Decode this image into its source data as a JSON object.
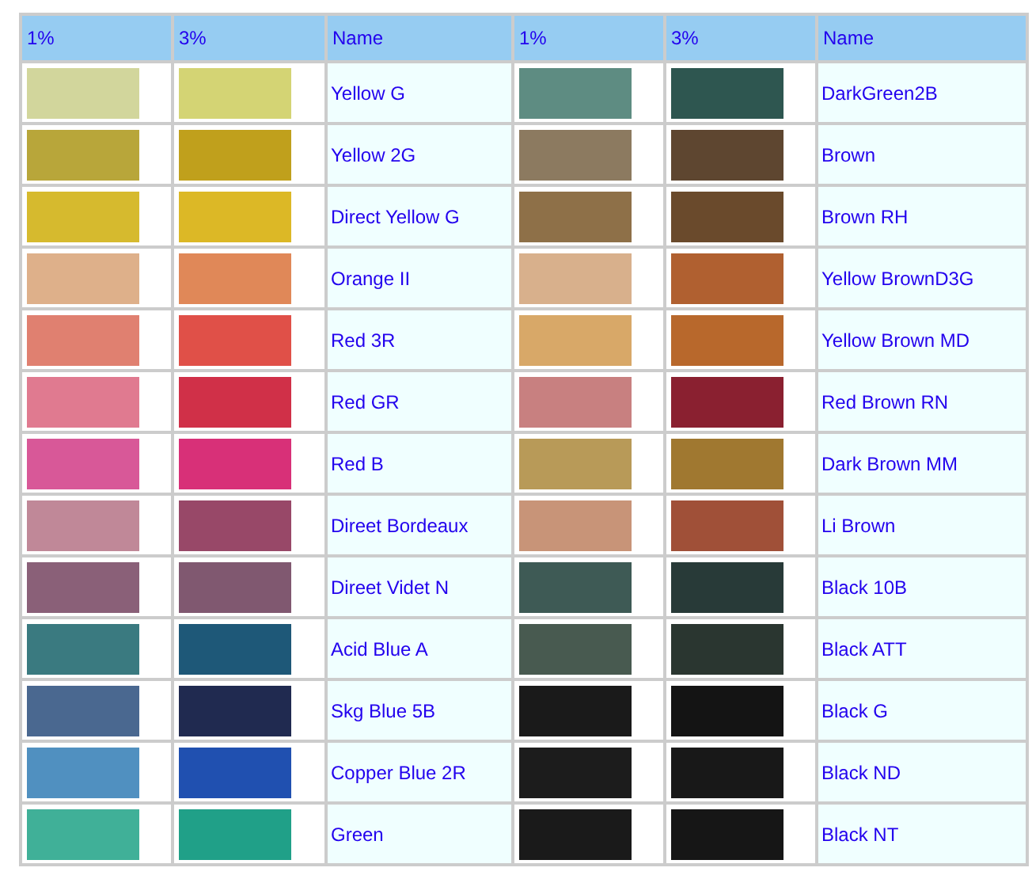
{
  "table": {
    "columns": [
      "1%",
      "3%",
      "Name",
      "1%",
      "3%",
      "Name"
    ],
    "rows": [
      {
        "samples": [
          {
            "swatches": [
              {
                "color": "#d2d69c"
              },
              {
                "color": "#d4d474"
              }
            ],
            "name": "Yellow G"
          },
          {
            "swatches": [
              {
                "color": "#5e8c82"
              },
              {
                "color": "#2e5650"
              }
            ],
            "name": "DarkGreen2B"
          }
        ]
      },
      {
        "samples": [
          {
            "swatches": [
              {
                "color": "#b8a63a"
              },
              {
                "color": "#c0a01c"
              }
            ],
            "name": "Yellow 2G"
          },
          {
            "swatches": [
              {
                "color": "#8c7a60"
              },
              {
                "color": "#5e4630"
              }
            ],
            "name": "Brown"
          }
        ]
      },
      {
        "samples": [
          {
            "swatches": [
              {
                "color": "#d6ba2e"
              },
              {
                "color": "#dcb826"
              }
            ],
            "name": "Direct Yellow G"
          },
          {
            "swatches": [
              {
                "color": "#8e7048"
              },
              {
                "color": "#6a4a2c"
              }
            ],
            "name": "Brown RH"
          }
        ]
      },
      {
        "samples": [
          {
            "swatches": [
              {
                "color": "#deb08a"
              },
              {
                "color": "#e08858"
              }
            ],
            "name": "Orange II"
          },
          {
            "swatches": [
              {
                "color": "#d8b08c"
              },
              {
                "color": "#b06030"
              }
            ],
            "name": "Yellow BrownD3G"
          }
        ]
      },
      {
        "samples": [
          {
            "swatches": [
              {
                "color": "#e08070"
              },
              {
                "color": "#e05048"
              }
            ],
            "name": "Red 3R"
          },
          {
            "swatches": [
              {
                "color": "#d8a868"
              },
              {
                "color": "#b8682c"
              }
            ],
            "name": "Yellow Brown MD"
          }
        ]
      },
      {
        "samples": [
          {
            "swatches": [
              {
                "color": "#e07a90"
              },
              {
                "color": "#d03048"
              }
            ],
            "name": "Red GR"
          },
          {
            "swatches": [
              {
                "color": "#c88080"
              },
              {
                "color": "#8a2030"
              }
            ],
            "name": "Red Brown RN"
          }
        ]
      },
      {
        "samples": [
          {
            "swatches": [
              {
                "color": "#d85898"
              },
              {
                "color": "#d83078"
              }
            ],
            "name": "Red B"
          },
          {
            "swatches": [
              {
                "color": "#b89a58"
              },
              {
                "color": "#a07830"
              }
            ],
            "name": "Dark Brown MM"
          }
        ]
      },
      {
        "samples": [
          {
            "swatches": [
              {
                "color": "#c08898"
              },
              {
                "color": "#984868"
              }
            ],
            "name": "Direet Bordeaux"
          },
          {
            "swatches": [
              {
                "color": "#c89478"
              },
              {
                "color": "#a05038"
              }
            ],
            "name": "Li Brown"
          }
        ]
      },
      {
        "samples": [
          {
            "swatches": [
              {
                "color": "#8a6078"
              },
              {
                "color": "#805870"
              }
            ],
            "name": "Direet Videt N"
          },
          {
            "swatches": [
              {
                "color": "#3e5a55"
              },
              {
                "color": "#283a38"
              }
            ],
            "name": "Black 10B"
          }
        ]
      },
      {
        "samples": [
          {
            "swatches": [
              {
                "color": "#3a7a80"
              },
              {
                "color": "#1e5878"
              }
            ],
            "name": "Acid Blue A"
          },
          {
            "swatches": [
              {
                "color": "#485a50"
              },
              {
                "color": "#2a3630"
              }
            ],
            "name": "Black ATT"
          }
        ]
      },
      {
        "samples": [
          {
            "swatches": [
              {
                "color": "#4a6890"
              },
              {
                "color": "#202a50"
              }
            ],
            "name": "Skg Blue 5B"
          },
          {
            "swatches": [
              {
                "color": "#1a1a1a"
              },
              {
                "color": "#141414"
              }
            ],
            "name": "Black G"
          }
        ]
      },
      {
        "samples": [
          {
            "swatches": [
              {
                "color": "#5090c0"
              },
              {
                "color": "#2050b0"
              }
            ],
            "name": "Copper Blue 2R"
          },
          {
            "swatches": [
              {
                "color": "#1c1c1c"
              },
              {
                "color": "#181818"
              }
            ],
            "name": "Black ND"
          }
        ]
      },
      {
        "samples": [
          {
            "swatches": [
              {
                "color": "#40b098"
              },
              {
                "color": "#20a088"
              }
            ],
            "name": "Green"
          },
          {
            "swatches": [
              {
                "color": "#1a1a1a"
              },
              {
                "color": "#161616"
              }
            ],
            "name": "Black NT"
          }
        ]
      }
    ]
  }
}
